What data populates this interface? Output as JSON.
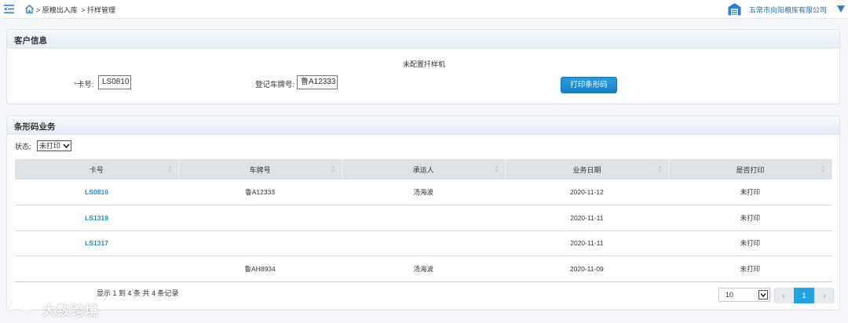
{
  "topbar": {
    "breadcrumb": [
      "> 原粮出入库",
      "> 扦样管理"
    ],
    "company": "五常市向阳粮库有限公司"
  },
  "customer_panel": {
    "title": "客户信息",
    "notice": "未配置扦样机",
    "card_label_required": "*",
    "card_label": "卡号:",
    "card_value": "LS0810",
    "plate_label": "登记车牌号:",
    "plate_value": "鲁A12333",
    "print_button": "打印条形码"
  },
  "barcode_panel": {
    "title": "条形码业务",
    "status_label": "状态:",
    "status_value": "未打印",
    "columns": [
      "卡号",
      "车牌号",
      "承运人",
      "业务日期",
      "是否打印"
    ],
    "rows": [
      {
        "card": "LS0810",
        "plate": "鲁A12333",
        "carrier": "汤海波",
        "date": "2020-11-12",
        "printed": "未打印"
      },
      {
        "card": "LS1318",
        "plate": "",
        "carrier": "",
        "date": "2020-11-11",
        "printed": "未打印"
      },
      {
        "card": "LS1317",
        "plate": "",
        "carrier": "",
        "date": "2020-11-11",
        "printed": "未打印"
      },
      {
        "card": "",
        "plate": "鲁AH8934",
        "carrier": "汤海波",
        "date": "2020-11-09",
        "printed": "未打印"
      }
    ],
    "summary": "显示 1 到 4 条 共 4 条记录",
    "page_size": "10",
    "pager": {
      "prev": "‹",
      "current": "1",
      "next": "›"
    }
  },
  "watermark": "大数跨境",
  "colors": {
    "accent": "#1fa3e3",
    "link": "#1e8fd0",
    "required": "#e03030",
    "company": "#1f6fc0"
  }
}
